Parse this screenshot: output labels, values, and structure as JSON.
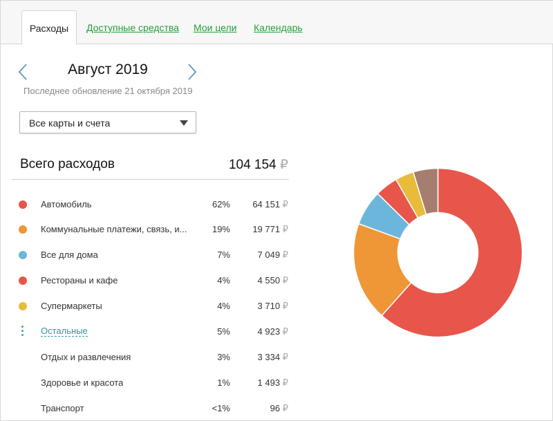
{
  "tabs": [
    {
      "label": "Расходы",
      "active": true
    },
    {
      "label": "Доступные средства",
      "active": false
    },
    {
      "label": "Мои цели",
      "active": false
    },
    {
      "label": "Календарь",
      "active": false
    }
  ],
  "period": {
    "month": "Август 2019",
    "updated": "Последнее обновление 21 октября 2019",
    "prev_icon": "chevron-left-icon",
    "next_icon": "chevron-right-icon"
  },
  "filter": {
    "selected": "Все карты и счета",
    "icon": "caret-down-icon"
  },
  "total": {
    "label": "Всего расходов",
    "amount": "104 154",
    "currency": "₽"
  },
  "categories": [
    {
      "name": "Автомобиль",
      "percent": "62%",
      "amount": "64 151",
      "currency": "₽",
      "color": "#e8554a"
    },
    {
      "name": "Коммунальные платежи, связь, и...",
      "percent": "19%",
      "amount": "19 771",
      "currency": "₽",
      "color": "#ef9637"
    },
    {
      "name": "Все для дома",
      "percent": "7%",
      "amount": "7 049",
      "currency": "₽",
      "color": "#6cb6dc"
    },
    {
      "name": "Рестораны и кафе",
      "percent": "4%",
      "amount": "4 550",
      "currency": "₽",
      "color": "#e8554a"
    },
    {
      "name": "Супермаркеты",
      "percent": "4%",
      "amount": "3 710",
      "currency": "₽",
      "color": "#e9bb3a"
    }
  ],
  "others": {
    "name": "Остальные",
    "percent": "5%",
    "amount": "4 923",
    "currency": "₽",
    "icon": "vertical-dots-icon",
    "color": "#a57e6f",
    "items": [
      {
        "name": "Отдых и развлечения",
        "percent": "3%",
        "amount": "3 334",
        "currency": "₽"
      },
      {
        "name": "Здоровье и красота",
        "percent": "1%",
        "amount": "1 493",
        "currency": "₽"
      },
      {
        "name": "Транспорт",
        "percent": "<1%",
        "amount": "96",
        "currency": "₽"
      }
    ]
  },
  "chart_data": {
    "type": "pie",
    "categories": [
      "Автомобиль",
      "Коммунальные платежи, связь, и...",
      "Все для дома",
      "Рестораны и кафе",
      "Супермаркеты",
      "Остальные"
    ],
    "values": [
      64151,
      19771,
      7049,
      4550,
      3710,
      4923
    ],
    "colors": [
      "#e8554a",
      "#ef9637",
      "#6cb6dc",
      "#e8554a",
      "#e9bb3a",
      "#a57e6f"
    ],
    "donut": true
  }
}
